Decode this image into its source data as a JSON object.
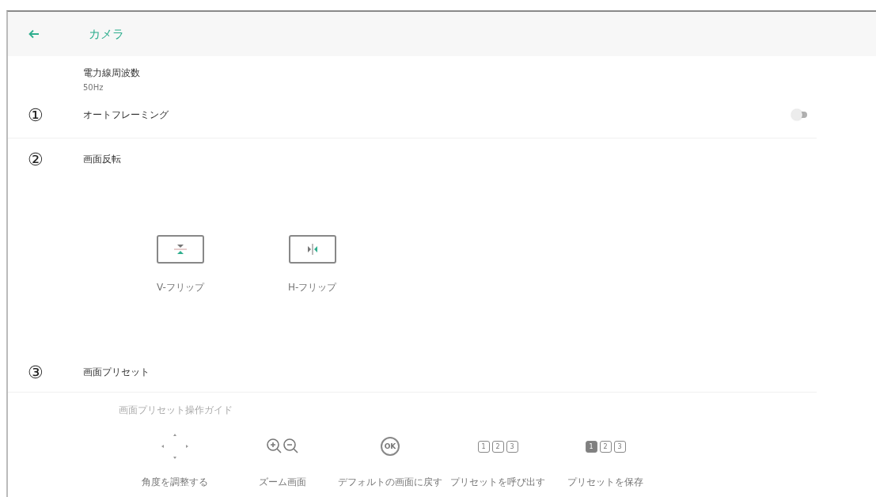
{
  "header": {
    "title": "カメラ"
  },
  "power_frequency": {
    "label": "電力線周波数",
    "value": "50Hz"
  },
  "auto_framing": {
    "marker": "①",
    "label": "オートフレーミング",
    "on": false
  },
  "flip": {
    "marker": "②",
    "label": "画面反転",
    "options": [
      {
        "kind": "vertical",
        "label": "V-フリップ"
      },
      {
        "kind": "horizontal",
        "label": "H-フリップ"
      }
    ]
  },
  "presets": {
    "marker": "③",
    "label": "画面プリセット",
    "guide_title": "画面プリセット操作ガイド",
    "guide": [
      {
        "kind": "dpad",
        "label": "角度を調整する"
      },
      {
        "kind": "zoom",
        "label": "ズーム画面"
      },
      {
        "kind": "ok",
        "badge": "OK",
        "label": "デフォルトの画面に戻す"
      },
      {
        "kind": "keys",
        "keys": [
          {
            "text": "1",
            "selected": false
          },
          {
            "text": "2",
            "selected": false
          },
          {
            "text": "3",
            "selected": false
          }
        ],
        "label": "プリセットを呼び出す"
      },
      {
        "kind": "keys",
        "keys": [
          {
            "text": "1",
            "selected": true
          },
          {
            "text": "2",
            "selected": false
          },
          {
            "text": "3",
            "selected": false
          }
        ],
        "label": "プリセットを保存"
      }
    ]
  }
}
